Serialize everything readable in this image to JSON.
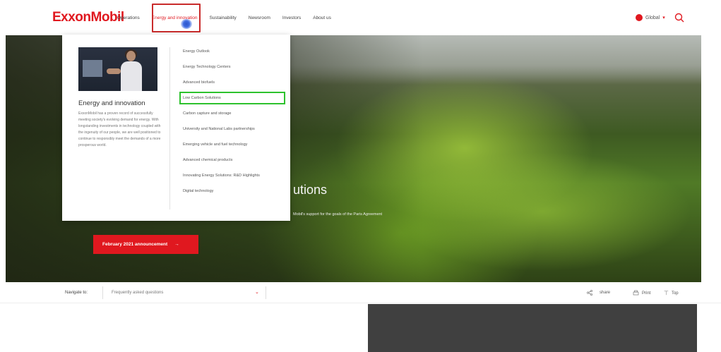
{
  "header": {
    "logo": "ExxonMobil",
    "nav": [
      {
        "label": "Operations",
        "active": false
      },
      {
        "label": "Energy and innovation",
        "active": true
      },
      {
        "label": "Sustainability",
        "active": false
      },
      {
        "label": "Newsroom",
        "active": false
      },
      {
        "label": "Investors",
        "active": false
      },
      {
        "label": "About us",
        "active": false
      }
    ],
    "region": "Global",
    "region_chevron": "▾"
  },
  "menu": {
    "heading": "Energy and innovation",
    "description": "ExxonMobil has a proven record of successfully meeting society's evolving demand for energy. With longstanding investments in technology coupled with the ingenuity of our people, we are well positioned to continue to responsibly meet the demands of a more prosperous world.",
    "links": [
      "Energy Outlook",
      "Energy Technology Centers",
      "Advanced biofuels",
      "Low Carbon Solutions",
      "Carbon capture and storage",
      "University and National Labs partnerships",
      "Emerging vehicle and fuel technology",
      "Advanced chemical products",
      "Innovating Energy Solutions: R&D Highlights",
      "Digital technology"
    ],
    "highlighted_link": "Low Carbon Solutions"
  },
  "hero": {
    "title": "utions",
    "subtitle": "Mobil's support for the goals of the Paris Agreement",
    "cta_label": "February 2021 announcement",
    "cta_arrow": "→"
  },
  "strip": {
    "navigate_label": "Navigate to:",
    "select_value": "Frequently asked questions",
    "share": "share",
    "print": "Print",
    "top": "Top"
  },
  "colors": {
    "brand_red": "#e0181f",
    "highlight_green": "#2ec22e",
    "active_box": "#c92b2b"
  }
}
